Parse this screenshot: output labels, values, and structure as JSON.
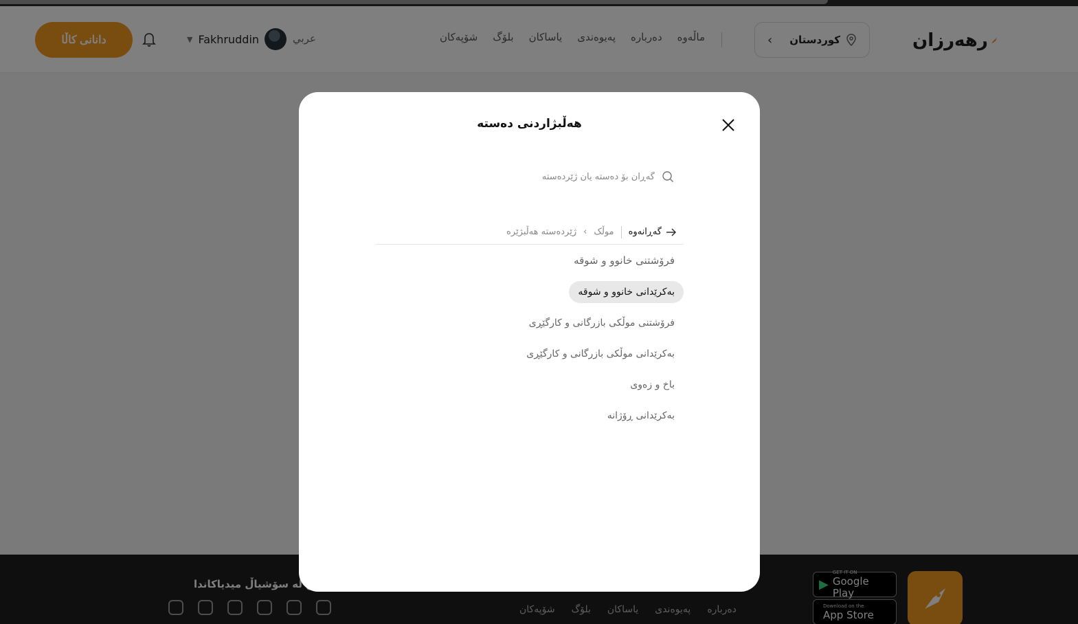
{
  "header": {
    "logo_text": "رهەرزان",
    "location": "کوردستان",
    "nav": [
      "ماڵەوە",
      "دەربارە",
      "پەیوەندی",
      "یاساکان",
      "بلۆگ",
      "شۆپەکان"
    ],
    "language": "عربي",
    "user_name": "Fakhruddin",
    "cta_label": "دانانی کاڵا"
  },
  "modal": {
    "title": "هەڵبژاردنی دەستە",
    "search_placeholder": "گەڕان بۆ دەستە یان ژێردەستە",
    "back_label": "گەڕانەوە",
    "breadcrumb": [
      "موڵک",
      "ژێردەستە هەڵبژێرە"
    ],
    "items": [
      {
        "label": "فرۆشتنی خانوو و شوقە",
        "selected": false
      },
      {
        "label": "بەکرێدانی خانوو و شوقە",
        "selected": true
      },
      {
        "label": "فرۆشتنی موڵکی بازرگانی و کارگێڕی",
        "selected": false
      },
      {
        "label": "بەکرێدانی موڵکی بازرگانی و کارگێڕی",
        "selected": false
      },
      {
        "label": "باخ و زەوی",
        "selected": false
      },
      {
        "label": "بەکرێدانی ڕۆژانە",
        "selected": false
      }
    ]
  },
  "footer": {
    "social_title": "لەگەڵمان بن لە سۆشیاڵ میدیاکاندا",
    "links": [
      "دەربارە",
      "پەیوەندی",
      "یاساکان",
      "بلۆگ",
      "شۆپەکان"
    ],
    "google_play_small": "GET IT ON",
    "google_play_big": "Google Play",
    "app_store_small": "Download on the",
    "app_store_big": "App Store"
  },
  "colors": {
    "accent": "#f29a1f",
    "selected_bg": "#e8e8e8"
  }
}
